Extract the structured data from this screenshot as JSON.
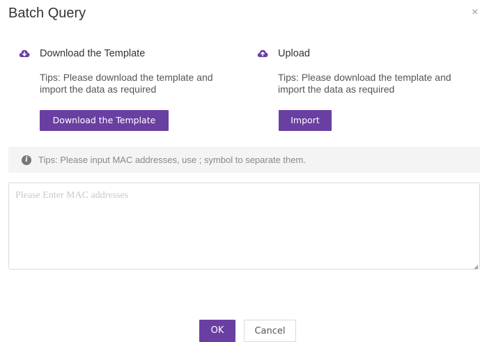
{
  "dialog": {
    "title": "Batch Query",
    "close_glyph": "×"
  },
  "download": {
    "icon": "cloud-download-icon",
    "title": "Download the Template",
    "tips": "Tips: Please download the template and import the data as required",
    "button_label": "Download the Template"
  },
  "upload": {
    "icon": "cloud-upload-icon",
    "title": "Upload",
    "tips": "Tips: Please download the template and import the data as required",
    "button_label": "Import"
  },
  "mac_tips": {
    "icon": "info-icon",
    "text": "Tips: Please input MAC addresses, use ; symbol to separate them."
  },
  "mac_input": {
    "placeholder": "Please Enter MAC addresses",
    "value": ""
  },
  "footer": {
    "ok_label": "OK",
    "cancel_label": "Cancel"
  },
  "colors": {
    "accent": "#6a3fa2",
    "tips_background": "#f4f4f4"
  }
}
